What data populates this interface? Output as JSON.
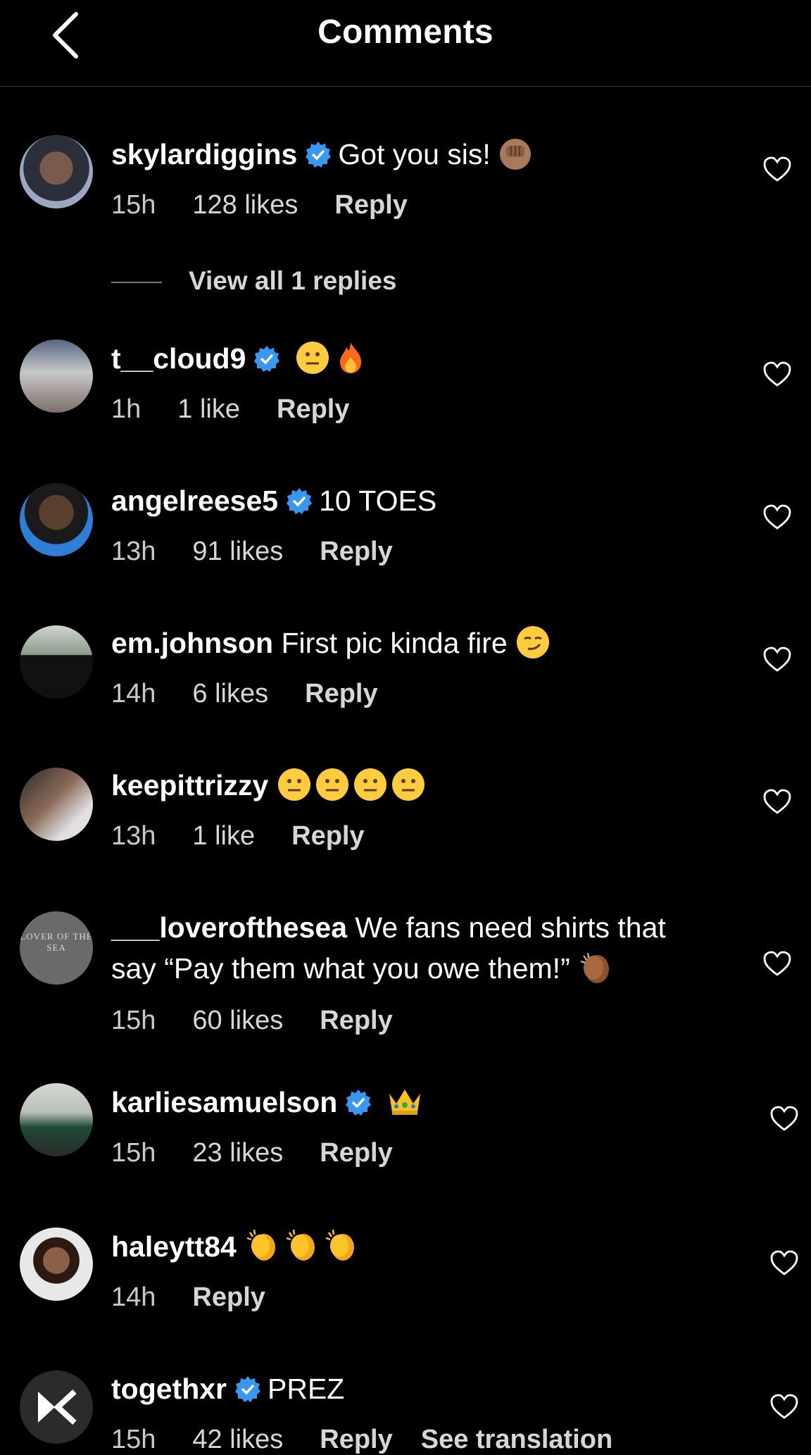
{
  "header": {
    "title": "Comments"
  },
  "comments": [
    {
      "username": "skylardiggins",
      "text": "Got you sis!",
      "time": "15h",
      "likes": "128 likes",
      "reply": "Reply",
      "view_replies": "View all 1 replies"
    },
    {
      "username": "t__cloud9",
      "text": "",
      "time": "1h",
      "likes": "1 like",
      "reply": "Reply"
    },
    {
      "username": "angelreese5",
      "text": "10 TOES",
      "time": "13h",
      "likes": "91 likes",
      "reply": "Reply"
    },
    {
      "username": "em.johnson",
      "text": "First pic kinda fire",
      "time": "14h",
      "likes": "6 likes",
      "reply": "Reply"
    },
    {
      "username": "keepittrizzy",
      "text": "",
      "time": "13h",
      "likes": "1 like",
      "reply": "Reply"
    },
    {
      "username": "___loverofthesea",
      "text": "We fans need shirts that",
      "text2": "say “Pay them what you owe them!”",
      "time": "15h",
      "likes": "60 likes",
      "reply": "Reply",
      "avatar_text": "LOVER OF THE SEA"
    },
    {
      "username": "karliesamuelson",
      "text": "",
      "time": "15h",
      "likes": "23 likes",
      "reply": "Reply"
    },
    {
      "username": "haleytt84",
      "text": "",
      "time": "14h",
      "reply": "Reply"
    },
    {
      "username": "togethxr",
      "text": "PREZ",
      "time": "15h",
      "likes": "42 likes",
      "reply": "Reply",
      "see_translation": "See translation"
    }
  ],
  "icons": {
    "back": "chevron-left-icon",
    "verified": "verified-badge-icon",
    "like": "heart-outline-icon"
  },
  "colors": {
    "background": "#000000",
    "verified": "#3897f0",
    "secondary_text": "#c9c9c9"
  }
}
